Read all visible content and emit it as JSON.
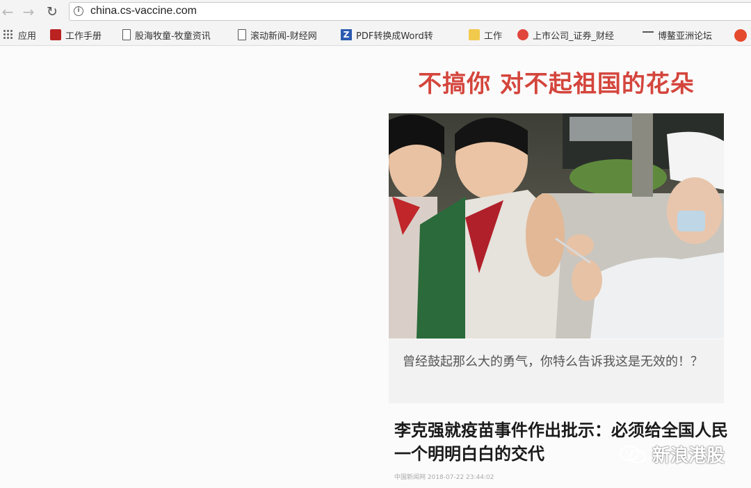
{
  "browser": {
    "url": "china.cs-vaccine.com",
    "bookmarks": [
      {
        "label": "应用",
        "icon": "apps-grid-icon"
      },
      {
        "label": "工作手册",
        "icon": "red-logo-icon"
      },
      {
        "label": "股海牧童-牧童资讯",
        "icon": "page-icon"
      },
      {
        "label": "滚动新闻-财经网",
        "icon": "page-icon"
      },
      {
        "label": "PDF转换成Word转",
        "icon": "z-logo-icon"
      },
      {
        "label": "工作",
        "icon": "folder-icon"
      },
      {
        "label": "上市公司_证券_财经",
        "icon": "weibo-icon"
      },
      {
        "label": "博鳌亚洲论坛",
        "icon": "dash-logo-icon"
      }
    ]
  },
  "page": {
    "headline": "不搞你 对不起祖国的花朵",
    "caption": "曾经鼓起那么大的勇气，你特么告诉我这是无效的！？",
    "article_title": "李克强就疫苗事件作出批示：必须给全国人民一个明明白白的交代",
    "meta": "中国新闻网  2018-07-22 23:44:02",
    "watermark": "新浪港股"
  }
}
